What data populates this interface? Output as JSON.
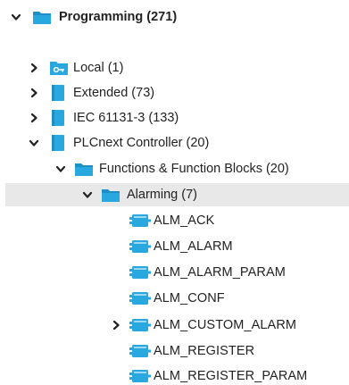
{
  "colors": {
    "folder": "#29a8e0",
    "folder_dark": "#1d8fc4",
    "library": "#29a8e0",
    "block": "#29a8e0",
    "chevron": "#222222",
    "selected_row": "#e8e8e8"
  },
  "tree": {
    "root": {
      "label": "Programming (271)",
      "icon": "folder-icon",
      "expanded": true
    },
    "libraries": [
      {
        "label": "Local (1)",
        "icon": "local-library-icon",
        "expanded": false
      },
      {
        "label": "Extended (73)",
        "icon": "library-icon",
        "expanded": false
      },
      {
        "label": "IEC 61131-3 (133)",
        "icon": "library-icon",
        "expanded": false
      },
      {
        "label": "PLCnext Controller (20)",
        "icon": "library-icon",
        "expanded": true
      }
    ],
    "functions_folder": {
      "label": "Functions & Function Blocks (20)",
      "icon": "folder-icon",
      "expanded": true
    },
    "alarming_folder": {
      "label": "Alarming (7)",
      "icon": "folder-icon",
      "expanded": true,
      "selected": true
    },
    "blocks": [
      {
        "label": "ALM_ACK",
        "icon": "function-block-icon"
      },
      {
        "label": "ALM_ALARM",
        "icon": "function-block-icon"
      },
      {
        "label": "ALM_ALARM_PARAM",
        "icon": "function-block-icon"
      },
      {
        "label": "ALM_CONF",
        "icon": "function-block-icon"
      },
      {
        "label": "ALM_CUSTOM_ALARM",
        "icon": "function-block-icon",
        "expandable": true
      },
      {
        "label": "ALM_REGISTER",
        "icon": "function-block-icon"
      },
      {
        "label": "ALM_REGISTER_PARAM",
        "icon": "function-block-icon"
      }
    ]
  }
}
